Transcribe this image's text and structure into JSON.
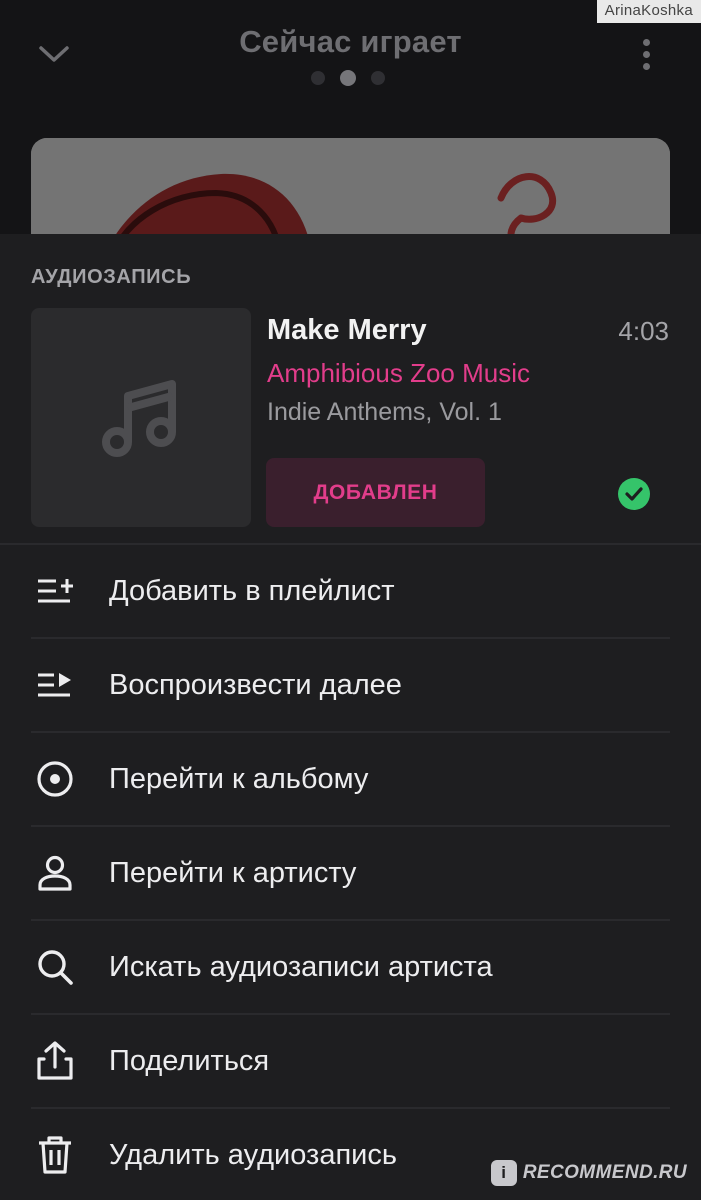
{
  "header": {
    "title": "Сейчас играет",
    "collapse_icon": "chevron-down-icon",
    "more_icon": "more-vertical-icon",
    "pager": {
      "count": 3,
      "active_index": 1
    }
  },
  "watermark": "ArinaKoshka",
  "sheet": {
    "caption": "АУДИОЗАПИСЬ",
    "track": {
      "title": "Make Merry",
      "artist": "Amphibious Zoo Music",
      "album": "Indie Anthems, Vol. 1",
      "duration": "4:03",
      "added_label": "ДОБАВЛЕН",
      "saved": true
    },
    "menu": [
      {
        "icon": "playlist-add-icon",
        "label": "Добавить в плейлист"
      },
      {
        "icon": "play-next-icon",
        "label": "Воспроизвести далее"
      },
      {
        "icon": "album-icon",
        "label": "Перейти к альбому"
      },
      {
        "icon": "user-icon",
        "label": "Перейти к артисту"
      },
      {
        "icon": "search-icon",
        "label": "Искать аудиозаписи артиста"
      },
      {
        "icon": "share-icon",
        "label": "Поделиться"
      },
      {
        "icon": "trash-icon",
        "label": "Удалить аудиозапись"
      }
    ]
  },
  "brand": {
    "badge": "i",
    "text": "RECOMMEND.RU"
  },
  "colors": {
    "accent": "#e23d8b",
    "success": "#35c46a",
    "sheet_bg": "#1e1e20",
    "text_primary": "#ededef",
    "text_secondary": "#9a9a9e"
  }
}
